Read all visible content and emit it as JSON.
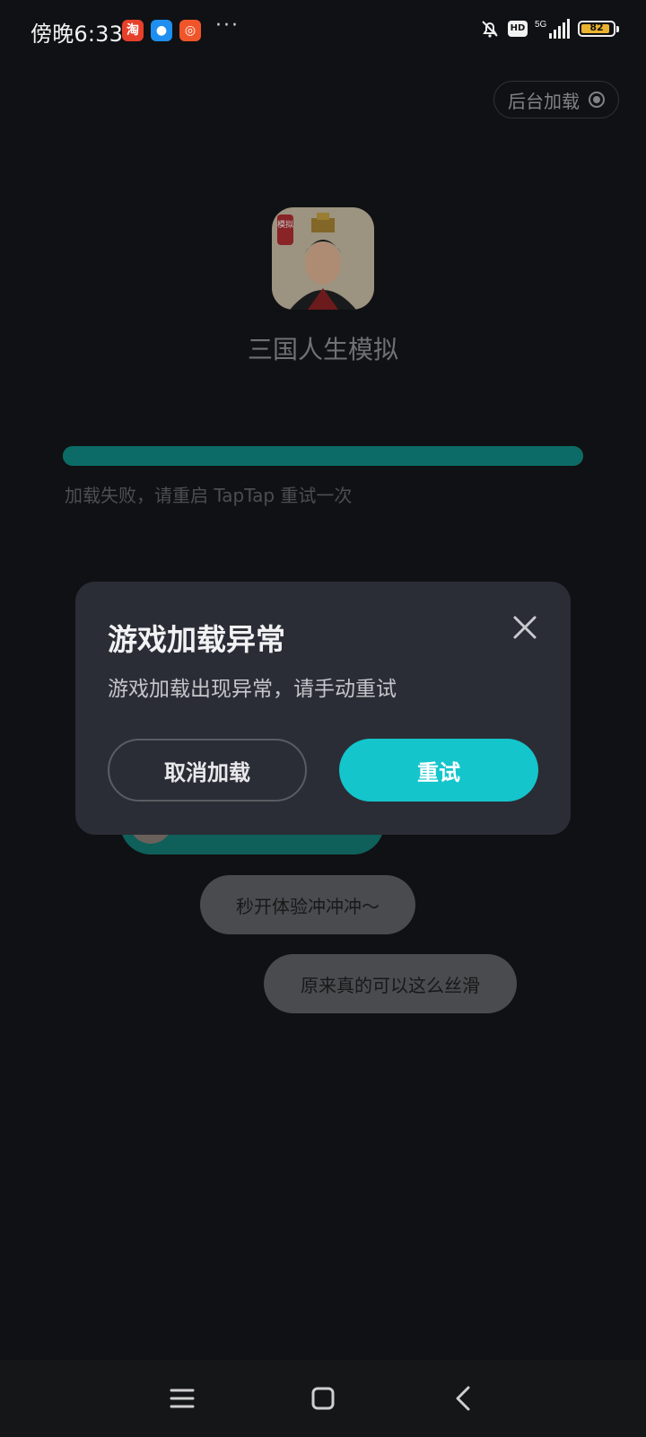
{
  "status_bar": {
    "time": "傍晚6:33",
    "notification_apps": [
      "taobao-icon",
      "message-bubble-icon",
      "kuaishou-icon"
    ],
    "more": "···",
    "hd_label": "HD",
    "network": "5G",
    "battery_level": "82"
  },
  "header": {
    "background_load_label": "后台加载"
  },
  "game": {
    "title": "三国人生模拟",
    "icon_badge": "模拟"
  },
  "loading": {
    "fail_message": "加载失败，请重启 TapTap 重试一次"
  },
  "bubbles": [
    {
      "text": ""
    },
    {
      "text": "秒开体验冲冲冲～"
    },
    {
      "text": "原来真的可以这么丝滑"
    }
  ],
  "dialog": {
    "title": "游戏加载异常",
    "message": "游戏加载出现异常，请手动重试",
    "cancel_label": "取消加载",
    "retry_label": "重试"
  },
  "nav": {
    "items": [
      "menu-icon",
      "home-icon",
      "back-icon"
    ]
  },
  "colors": {
    "accent": "#14c5cc",
    "progress": "#0c6b66",
    "dialog_bg": "#2b2d36",
    "page_bg": "#101114"
  }
}
